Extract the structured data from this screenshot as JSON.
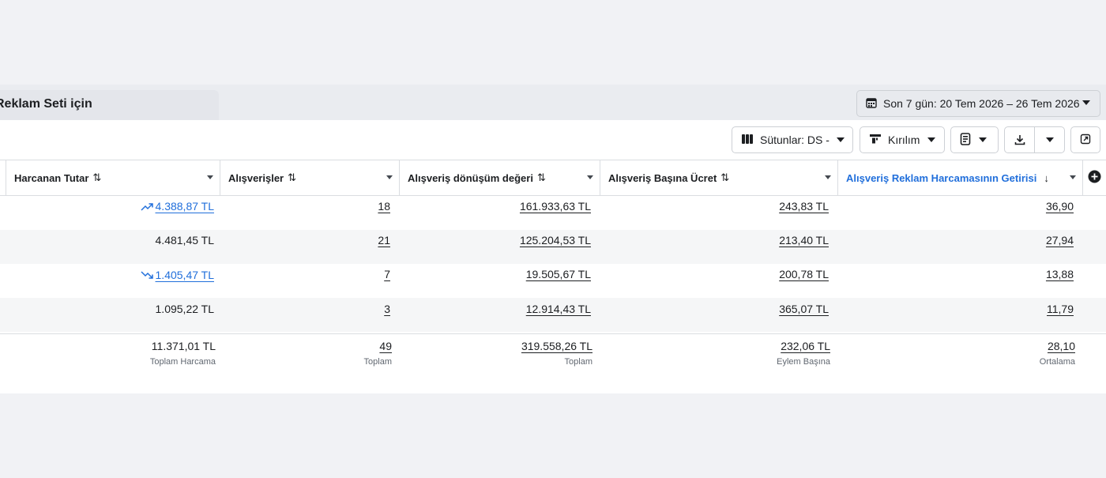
{
  "tab": {
    "title": "Reklam Seti için"
  },
  "date_range": {
    "label": "Son 7 gün: 20 Tem 2026 – 26 Tem 2026"
  },
  "toolbar": {
    "columns_label": "Sütunlar: DS -",
    "breakdown_label": "Kırılım"
  },
  "columns": [
    {
      "label": "Harcanan Tutar",
      "sort": "⇅"
    },
    {
      "label": "Alışverişler",
      "sort": "⇅"
    },
    {
      "label": "Alışveriş dönüşüm değeri",
      "sort": "⇅"
    },
    {
      "label": "Alışveriş Başına Ücret",
      "sort": "⇅"
    },
    {
      "label": "Alışveriş Reklam Harcamasının Getirisi",
      "sort": "↓"
    }
  ],
  "rows": [
    {
      "spend": "4.388,87 TL",
      "spend_trend": "up",
      "purchases": "18",
      "value": "161.933,63 TL",
      "cpp": "243,83 TL",
      "roas": "36,90"
    },
    {
      "spend": "4.481,45 TL",
      "spend_trend": "",
      "purchases": "21",
      "value": "125.204,53 TL",
      "cpp": "213,40 TL",
      "roas": "27,94"
    },
    {
      "spend": "1.405,47 TL",
      "spend_trend": "down",
      "purchases": "7",
      "value": "19.505,67 TL",
      "cpp": "200,78 TL",
      "roas": "13,88"
    },
    {
      "spend": "1.095,22 TL",
      "spend_trend": "",
      "purchases": "3",
      "value": "12.914,43 TL",
      "cpp": "365,07 TL",
      "roas": "11,79"
    }
  ],
  "totals": {
    "spend": {
      "value": "11.371,01 TL",
      "sub": "Toplam Harcama"
    },
    "purchases": {
      "value": "49",
      "sub": "Toplam"
    },
    "value": {
      "value": "319.558,26 TL",
      "sub": "Toplam"
    },
    "cpp": {
      "value": "232,06 TL",
      "sub": "Eylem Başına"
    },
    "roas": {
      "value": "28,10",
      "sub": "Ortalama"
    }
  },
  "colors": {
    "link_blue": "#216fdb",
    "accent_header": "#216fdb"
  }
}
